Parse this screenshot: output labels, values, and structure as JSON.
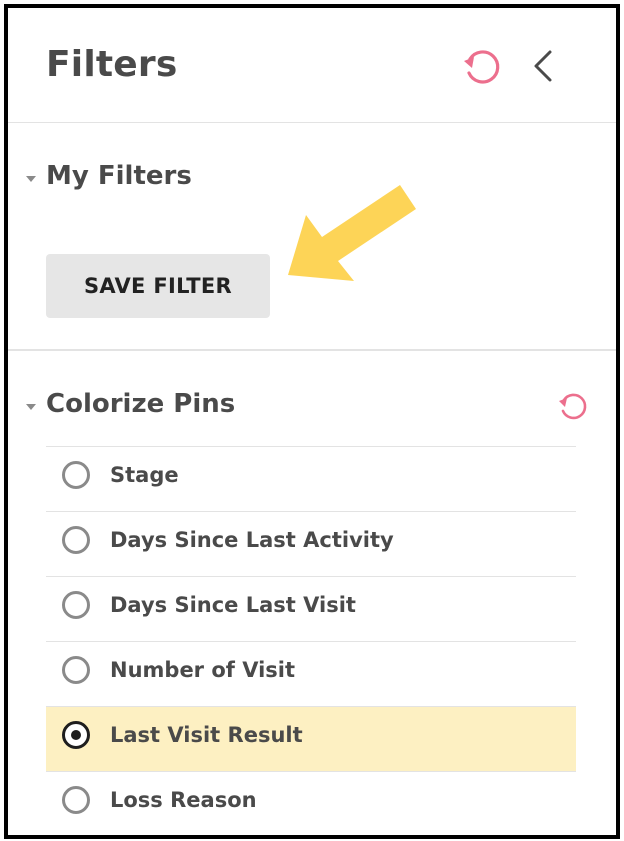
{
  "header": {
    "title": "Filters",
    "reset_icon": "reset-icon",
    "back_icon": "chevron-left-icon"
  },
  "my_filters": {
    "title": "My Filters",
    "save_label": "SAVE FILTER",
    "annotation_arrow_color": "#fdd457"
  },
  "colorize_pins": {
    "title": "Colorize Pins",
    "reset_icon": "reset-icon",
    "options": [
      {
        "label": "Stage",
        "selected": false
      },
      {
        "label": "Days Since Last Activity",
        "selected": false
      },
      {
        "label": "Days Since Last Visit",
        "selected": false
      },
      {
        "label": "Number of Visit",
        "selected": false
      },
      {
        "label": "Last Visit Result",
        "selected": true
      },
      {
        "label": "Loss Reason",
        "selected": false
      }
    ]
  },
  "colors": {
    "accent_pink": "#ec6f8d",
    "selected_bg": "#fdf0c2",
    "text": "#4a4a4a"
  }
}
